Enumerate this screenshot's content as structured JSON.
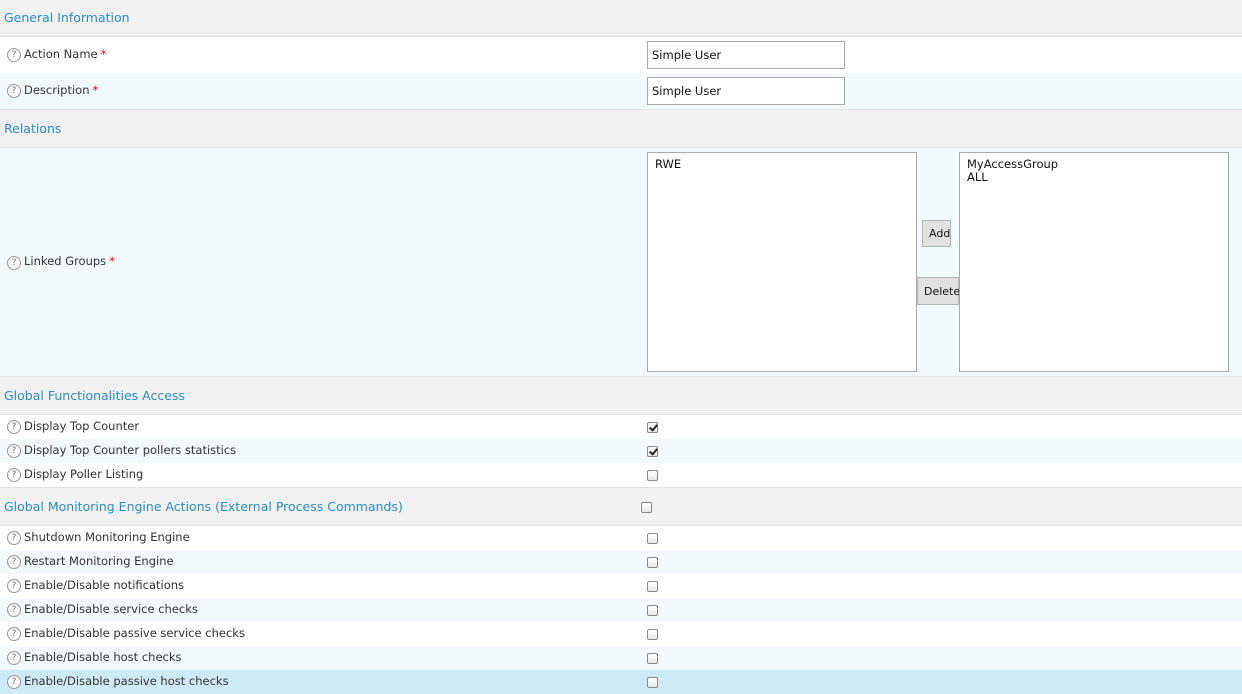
{
  "sections": {
    "general": "General Information",
    "relations": "Relations",
    "global_func": "Global Functionalities Access",
    "monitoring": "Global Monitoring Engine Actions (External Process Commands)"
  },
  "help_glyph": "?",
  "required_mark": "*",
  "general": {
    "action_name_label": "Action Name",
    "action_name_value": "Simple User",
    "description_label": "Description",
    "description_value": "Simple User"
  },
  "relations": {
    "linked_groups_label": "Linked Groups",
    "available": [
      "RWE"
    ],
    "selected": [
      "MyAccessGroup",
      "ALL"
    ],
    "add_label": "Add",
    "delete_label": "Delete"
  },
  "global_func": [
    {
      "label": "Display Top Counter",
      "checked": true
    },
    {
      "label": "Display Top Counter pollers statistics",
      "checked": true
    },
    {
      "label": "Display Poller Listing",
      "checked": false
    }
  ],
  "monitoring_all_checked": false,
  "monitoring": [
    {
      "label": "Shutdown Monitoring Engine",
      "checked": false
    },
    {
      "label": "Restart Monitoring Engine",
      "checked": false
    },
    {
      "label": "Enable/Disable notifications",
      "checked": false
    },
    {
      "label": "Enable/Disable service checks",
      "checked": false
    },
    {
      "label": "Enable/Disable passive service checks",
      "checked": false
    },
    {
      "label": "Enable/Disable host checks",
      "checked": false
    },
    {
      "label": "Enable/Disable passive host checks",
      "checked": false
    }
  ]
}
